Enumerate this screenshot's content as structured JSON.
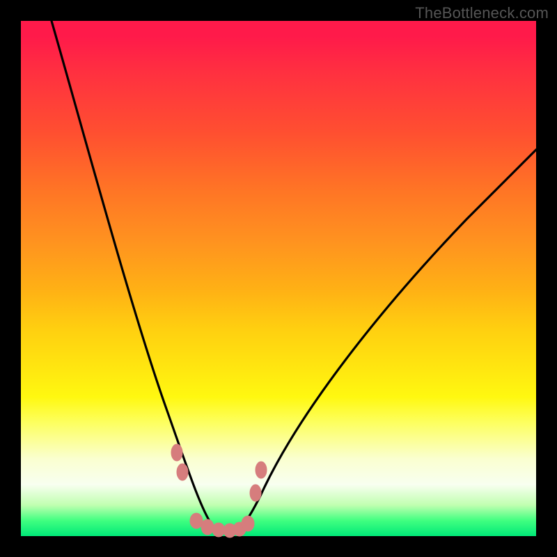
{
  "watermark": "TheBottleneck.com",
  "chart_data": {
    "type": "line",
    "title": "",
    "xlabel": "",
    "ylabel": "",
    "xlim": [
      0,
      100
    ],
    "ylim": [
      0,
      100
    ],
    "grid": false,
    "legend": false,
    "series": [
      {
        "name": "bottleneck-curve",
        "color": "#000000",
        "x": [
          6,
          10,
          15,
          20,
          25,
          28,
          30,
          32,
          34,
          36,
          38,
          40,
          42,
          45,
          50,
          55,
          60,
          65,
          70,
          75,
          80,
          85,
          90,
          95,
          100
        ],
        "y": [
          100,
          88,
          73,
          58,
          42,
          31,
          24,
          17,
          10,
          5,
          2,
          1,
          1,
          2,
          6,
          12,
          19,
          26,
          33,
          40,
          47,
          53,
          59,
          65,
          70
        ]
      }
    ],
    "annotations": {
      "markers": {
        "name": "datapoint-markers",
        "color": "#d67d7d",
        "x": [
          30,
          31,
          34,
          36,
          38,
          40,
          42,
          44,
          45,
          45.5
        ],
        "y": [
          16,
          12,
          2.5,
          1.5,
          1,
          1,
          1,
          2,
          8,
          13
        ]
      }
    },
    "background": "vertical-gradient-red-to-green"
  }
}
